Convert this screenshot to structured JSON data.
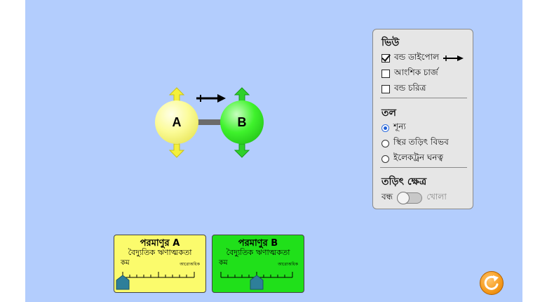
{
  "molecule": {
    "atom_a_label": "A",
    "atom_b_label": "B",
    "atom_a_color": "#fbfb96",
    "atom_b_color": "#3ff22c",
    "arrow_color_a": "#f4f03a",
    "arrow_color_b": "#2fd02a"
  },
  "panel": {
    "view_title": "ভিউ",
    "view_options": [
      {
        "label": "বন্ড ডাইপোল",
        "checked": true
      },
      {
        "label": "আংশিক চার্জ",
        "checked": false
      },
      {
        "label": "বন্ড চরিত্র",
        "checked": false
      }
    ],
    "surface_title": "তল",
    "surface_options": [
      {
        "label": "শূন্য",
        "selected": true
      },
      {
        "label": "স্থির তড়িৎ বিভব",
        "selected": false
      },
      {
        "label": "ইলেকট্রন ঘনত্ব",
        "selected": false
      }
    ],
    "field_title": "তড়িৎ ক্ষেত্র",
    "field_off": "বন্ধ",
    "field_on": "খোলা",
    "field_enabled": false
  },
  "electronegativity": {
    "atom_a": {
      "title": "পরমাণুর A",
      "subtitle": "বৈদ্যুতিক ঋণাত্মকতা",
      "less": "কম",
      "more": "আরোঅধিক",
      "value_fraction": 0.0,
      "color": "#fbfb6c"
    },
    "atom_b": {
      "title": "পরমাণুর B",
      "subtitle": "বৈদ্যুতিক ঋণাত্মকতা",
      "less": "কম",
      "more": "আরোঅধিক",
      "value_fraction": 0.5,
      "color": "#20e01a"
    }
  },
  "icons": {
    "reset": "reset-icon",
    "dipole": "dipole-arrow-icon",
    "thumb": "slider-thumb-icon"
  }
}
